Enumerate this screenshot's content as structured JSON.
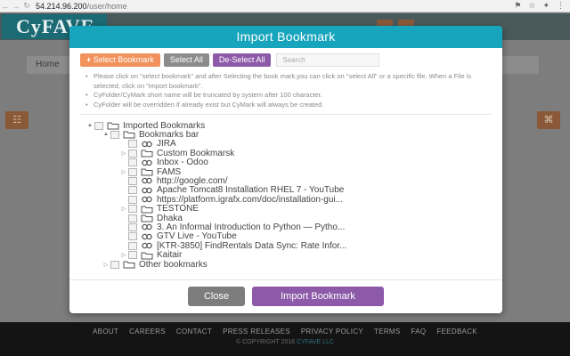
{
  "browser": {
    "back_glyph": "←",
    "forward_glyph": "→",
    "reload_glyph": "↻",
    "url_host": "54.214.96.200",
    "url_path": "/user/home"
  },
  "site": {
    "logo_text": "CyFAVE",
    "breadcrumb_home": "Home",
    "footer_links": [
      "ABOUT",
      "CAREERS",
      "CONTACT",
      "PRESS RELEASES",
      "PRIVACY POLICY",
      "TERMS",
      "FAQ",
      "FEEDBACK"
    ],
    "copyright_prefix": "© COPYRIGHT 2016",
    "copyright_brand": "CYFAVE LLC"
  },
  "modal": {
    "title": "Import Bookmark",
    "select_bookmark_label": "Select Bookmark",
    "select_all_label": "Select All",
    "deselect_all_label": "De-Select All",
    "search_placeholder": "Search",
    "notes": [
      "Please click on \"select bookmark\" and after Selecting the book mark,you can click on \"select All\" or a specific file. When a File is selected, click on \"import bookmark\".",
      "CyFolder/CyMark short name will be truncated by system after 100 character.",
      "CyFolder will be overridden if already exist but CyMark will always be created."
    ],
    "close_label": "Close",
    "import_label": "Import Bookmark"
  },
  "tree": [
    {
      "label": "Imported Bookmarks",
      "type": "folder",
      "toggle": "▲",
      "depth": 0
    },
    {
      "label": "Bookmarks bar",
      "type": "folder",
      "toggle": "▲",
      "depth": 1
    },
    {
      "label": "JIRA",
      "type": "link",
      "toggle": "",
      "depth": 2
    },
    {
      "label": "Custom Bookmarsk",
      "type": "folder",
      "toggle": "▷",
      "depth": 2
    },
    {
      "label": "Inbox - Odoo",
      "type": "link",
      "toggle": "",
      "depth": 2
    },
    {
      "label": "FAMS",
      "type": "folder",
      "toggle": "▷",
      "depth": 2
    },
    {
      "label": "http://google.com/",
      "type": "link",
      "toggle": "",
      "depth": 2
    },
    {
      "label": "Apache Tomcat8 Installation RHEL 7 - YouTube",
      "type": "link",
      "toggle": "",
      "depth": 2
    },
    {
      "label": "https://platform.igrafx.com/doc/installation-gui...",
      "type": "link",
      "toggle": "",
      "depth": 2
    },
    {
      "label": "TESTONE",
      "type": "folder",
      "toggle": "▷",
      "depth": 2
    },
    {
      "label": "Dhaka",
      "type": "folder",
      "toggle": "",
      "depth": 2
    },
    {
      "label": "3. An Informal Introduction to Python — Pytho...",
      "type": "link",
      "toggle": "",
      "depth": 2
    },
    {
      "label": "GTV Live - YouTube",
      "type": "link",
      "toggle": "",
      "depth": 2
    },
    {
      "label": "[KTR-3850] FindRentals Data Sync: Rate Infor...",
      "type": "link",
      "toggle": "",
      "depth": 2
    },
    {
      "label": "Kaitair",
      "type": "folder",
      "toggle": "▷",
      "depth": 2
    },
    {
      "label": "Other bookmarks",
      "type": "folder",
      "toggle": "▷",
      "depth": 1
    }
  ]
}
